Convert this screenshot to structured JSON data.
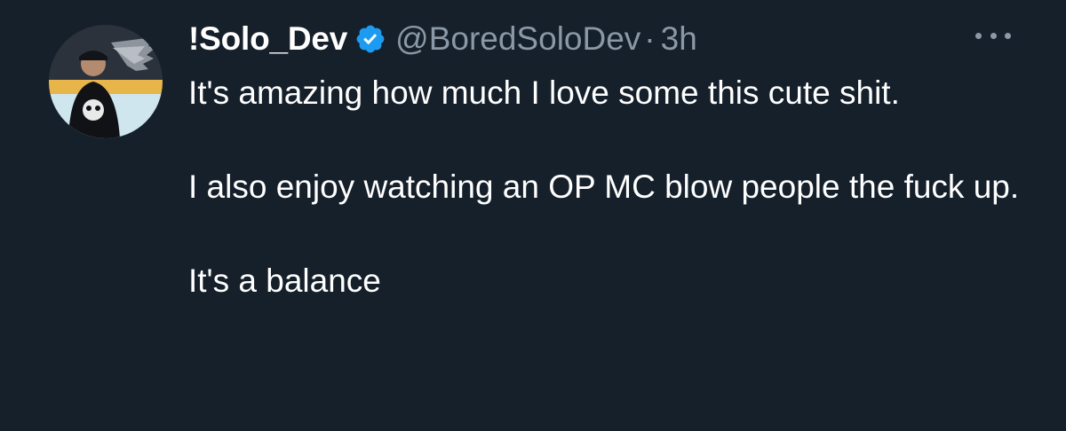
{
  "tweet": {
    "author": {
      "display_name": "!Solo_Dev",
      "handle": "@BoredSoloDev",
      "verified": true,
      "avatar": "avatar-icon"
    },
    "separator": "·",
    "time": "3h",
    "more_icon": "more-horizontal-icon",
    "paragraphs": [
      "It's amazing how much I love some this cute shit.",
      "I also enjoy watching an OP MC blow people the fuck up.",
      "It's a balance"
    ]
  },
  "colors": {
    "background": "#15202b",
    "primary_text": "#ffffff",
    "secondary_text": "#8b98a5",
    "verified_badge": "#1d9bf0"
  }
}
